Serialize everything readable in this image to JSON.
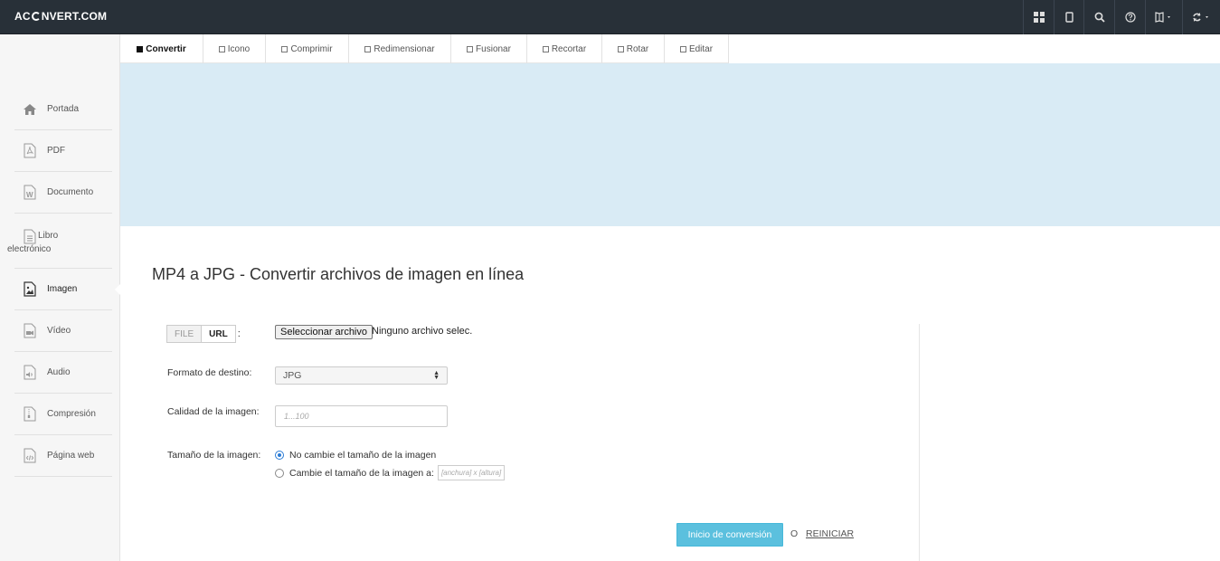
{
  "header": {
    "logo_prefix": "AC",
    "logo_suffix": "NVERT.COM",
    "icons": [
      "grid-icon",
      "mobile-icon",
      "search-icon",
      "help-icon",
      "language-icon",
      "refresh-icon"
    ]
  },
  "tabs": [
    {
      "label": "Convertir",
      "active": true
    },
    {
      "label": "Icono"
    },
    {
      "label": "Comprimir"
    },
    {
      "label": "Redimensionar"
    },
    {
      "label": "Fusionar"
    },
    {
      "label": "Recortar"
    },
    {
      "label": "Rotar"
    },
    {
      "label": "Editar"
    }
  ],
  "sidebar": {
    "items": [
      {
        "label": "Portada",
        "icon": "home-icon"
      },
      {
        "label": "PDF",
        "icon": "pdf-file-icon"
      },
      {
        "label": "Documento",
        "icon": "word-file-icon"
      },
      {
        "label": "Libro electrónico",
        "icon": "ebook-file-icon"
      },
      {
        "label": "Imagen",
        "icon": "image-file-icon",
        "active": true
      },
      {
        "label": "Vídeo",
        "icon": "video-file-icon"
      },
      {
        "label": "Audio",
        "icon": "audio-file-icon"
      },
      {
        "label": "Compresión",
        "icon": "archive-file-icon"
      },
      {
        "label": "Página web",
        "icon": "code-file-icon"
      }
    ]
  },
  "main": {
    "title": "MP4 a JPG - Convertir archivos de imagen en línea",
    "source_toggle": {
      "file": "FILE",
      "url": "URL",
      "separator": ":"
    },
    "file_button": "Seleccionar archivo",
    "file_status": "Ninguno archivo selec.",
    "target_format": {
      "label": "Formato de destino:",
      "value": "JPG"
    },
    "quality": {
      "label": "Calidad de la imagen:",
      "placeholder": "1...100"
    },
    "size": {
      "label": "Tamaño de la imagen:",
      "option_keep": "No cambie el tamaño de la imagen",
      "option_resize": "Cambie el tamaño de la imagen a:",
      "dims_placeholder": "[anchura] x [altura]"
    },
    "submit": "Inicio de conversión",
    "or": "O",
    "reset": "REINICIAR"
  },
  "colors": {
    "topbar": "#283038",
    "banner": "#d9ebf5",
    "submit": "#5bc0de",
    "radio_accent": "#2a7bd5"
  }
}
